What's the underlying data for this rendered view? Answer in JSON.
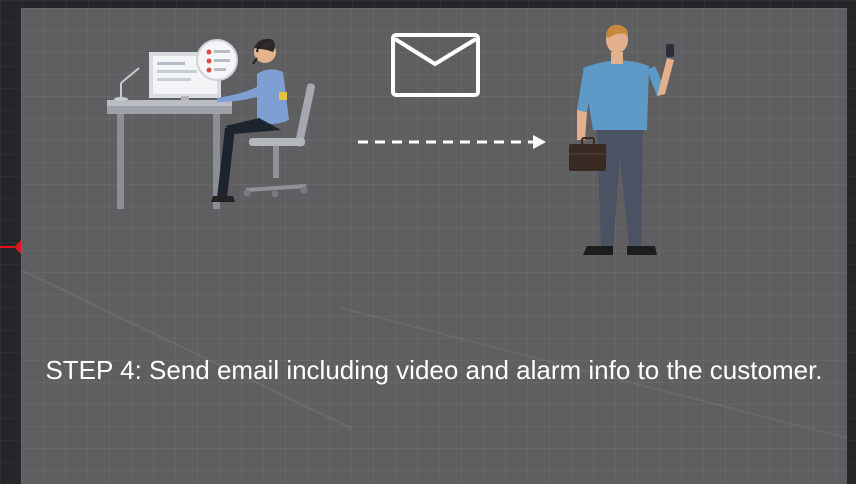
{
  "slide": {
    "caption": "STEP 4: Send email including video and alarm info to the customer."
  },
  "icons": {
    "operator": "operator-at-desk-icon",
    "email": "envelope-icon",
    "arrow": "dashed-arrow-icon",
    "customer": "customer-with-phone-icon",
    "marker": "timeline-keyframe-icon"
  },
  "colors": {
    "slide_background": "#5f5f62",
    "text": "#ffffff",
    "marker": "#e0141e"
  }
}
